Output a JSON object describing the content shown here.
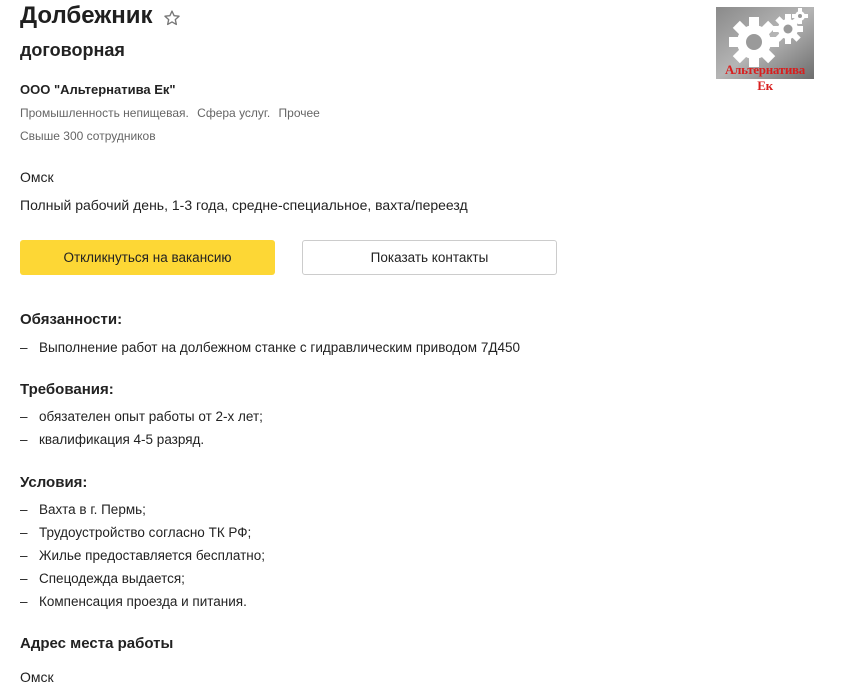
{
  "vacancy": {
    "title": "Долбежник",
    "salary": "договорная",
    "company": "ООО \"Альтернатива Ек\"",
    "industries": [
      "Промышленность непищевая.",
      "Сфера услуг.",
      "Прочее"
    ],
    "employees": "Свыше 300 сотрудников",
    "city": "Омск",
    "details": "Полный рабочий день, 1-3 года, средне-специальное, вахта/переезд"
  },
  "actions": {
    "respond_label": "Откликнуться на вакансию",
    "contacts_label": "Показать контакты"
  },
  "logo": {
    "text": "Альтернатива Ек"
  },
  "sections": {
    "duties": {
      "title": "Обязанности:",
      "items": [
        "Выполнение работ на долбежном станке с гидравлическим приводом 7Д450"
      ]
    },
    "requirements": {
      "title": "Требования:",
      "items": [
        "обязателен опыт работы от 2-х лет;",
        "квалификация 4-5 разряд."
      ]
    },
    "conditions": {
      "title": "Условия:",
      "items": [
        "Вахта в г. Пермь;",
        "Трудоустройство согласно ТК РФ;",
        "Жилье предоставляется бесплатно;",
        "Спецодежда выдается;",
        "Компенсация проезда и питания."
      ]
    },
    "address": {
      "title": "Адрес места работы",
      "value": "Омск"
    }
  },
  "bullet": "–",
  "colors": {
    "respond_button": "#fdd735",
    "logo_text": "#d81e1e",
    "secondary_text": "#666666"
  },
  "icons": {
    "favorite": "star-outline-icon"
  }
}
